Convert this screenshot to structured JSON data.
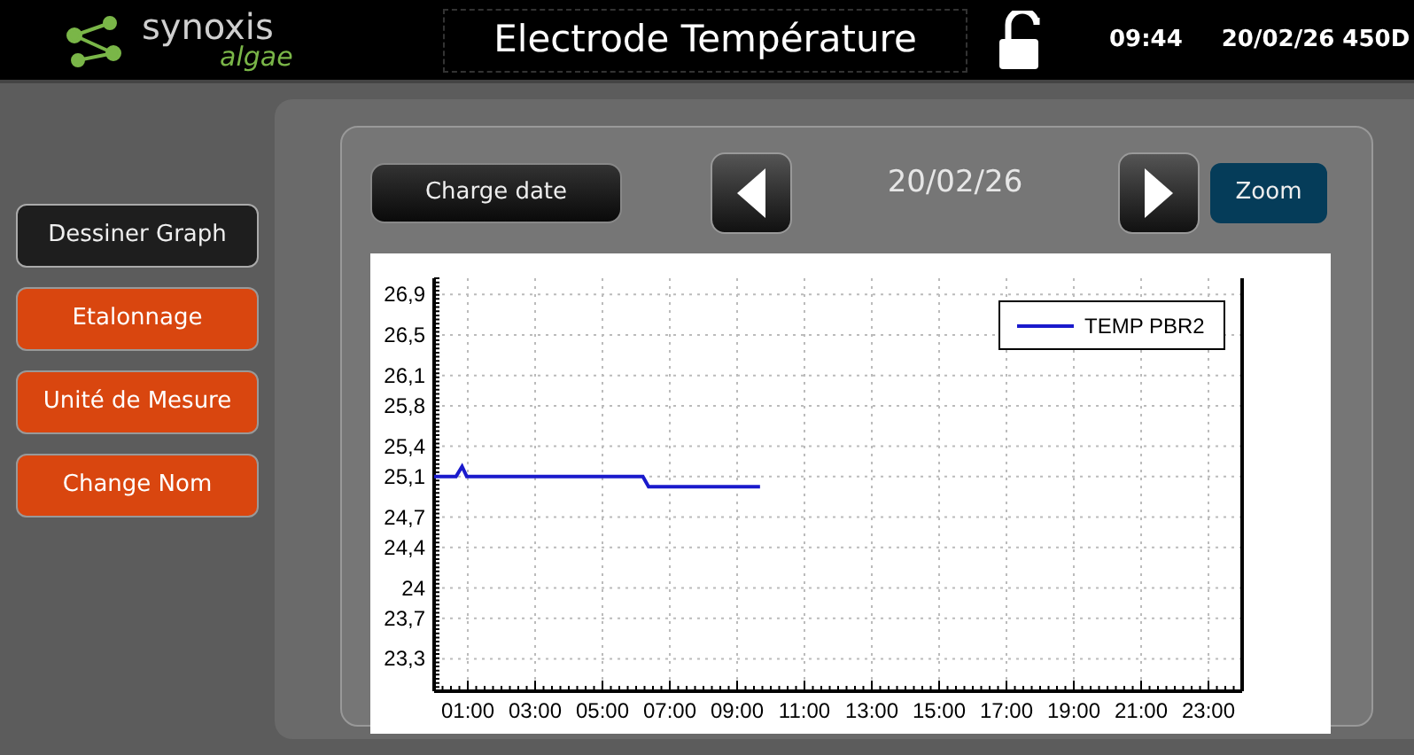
{
  "header": {
    "logo_main": "synoxis",
    "logo_sub": "algae",
    "title": "Electrode Température",
    "locked": false,
    "time": "09:44",
    "date": "20/02/26 450D"
  },
  "side_menu": [
    {
      "label": "Dessiner Graph",
      "selected": true
    },
    {
      "label": "Etalonnage",
      "selected": false
    },
    {
      "label": "Unité de Mesure",
      "selected": false
    },
    {
      "label": "Change Nom",
      "selected": false
    }
  ],
  "toolbar": {
    "load_button": "Charge date",
    "date": "20/02/26",
    "zoom_button": "Zoom"
  },
  "chart_data": {
    "type": "line",
    "x": [
      0,
      0.65,
      0.83,
      0.97,
      6.2,
      6.37,
      9.68
    ],
    "series": [
      {
        "name": "TEMP PBR2",
        "color": "#1a1acc",
        "values": [
          25.1,
          25.1,
          25.2,
          25.1,
          25.1,
          25.0,
          25.0
        ]
      }
    ],
    "xlim": [
      0,
      24
    ],
    "ylim": [
      22.98,
      27.06
    ],
    "grid": true,
    "xticks": [
      {
        "value": 1,
        "label": "01:00"
      },
      {
        "value": 3,
        "label": "03:00"
      },
      {
        "value": 5,
        "label": "05:00"
      },
      {
        "value": 7,
        "label": "07:00"
      },
      {
        "value": 9,
        "label": "09:00"
      },
      {
        "value": 11,
        "label": "11:00"
      },
      {
        "value": 13,
        "label": "13:00"
      },
      {
        "value": 15,
        "label": "15:00"
      },
      {
        "value": 17,
        "label": "17:00"
      },
      {
        "value": 19,
        "label": "19:00"
      },
      {
        "value": 21,
        "label": "21:00"
      },
      {
        "value": 23,
        "label": "23:00"
      }
    ],
    "yticks": [
      {
        "value": 23.3,
        "label": "23,3"
      },
      {
        "value": 23.7,
        "label": "23,7"
      },
      {
        "value": 24,
        "label": "24"
      },
      {
        "value": 24.4,
        "label": "24,4"
      },
      {
        "value": 24.7,
        "label": "24,7"
      },
      {
        "value": 25.1,
        "label": "25,1"
      },
      {
        "value": 25.4,
        "label": "25,4"
      },
      {
        "value": 25.8,
        "label": "25,8"
      },
      {
        "value": 26.1,
        "label": "26,1"
      },
      {
        "value": 26.5,
        "label": "26,5"
      },
      {
        "value": 26.9,
        "label": "26,9"
      }
    ]
  }
}
